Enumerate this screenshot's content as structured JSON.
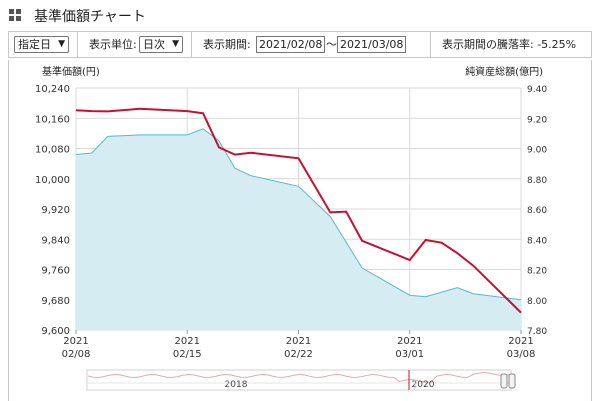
{
  "title": "基準価額チャート",
  "controls": {
    "period_select": "指定日",
    "unit_label": "表示単位:",
    "unit_select": "日次",
    "range_label": "表示期間:",
    "start_date": "2021/02/08",
    "range_sep": "〜",
    "end_date": "2021/03/08",
    "change_label": "表示期間の騰落率: -5.25%"
  },
  "chart_data": {
    "type": "line",
    "left_axis_title": "基準価額(円)",
    "right_axis_title": "純資産総額(億円)",
    "y_left_ticks": [
      "10,240",
      "10,160",
      "10,080",
      "10,000",
      "9,920",
      "9,840",
      "9,760",
      "9,680",
      "9,600"
    ],
    "y_right_ticks": [
      "9.40",
      "9.20",
      "9.00",
      "8.80",
      "8.60",
      "8.40",
      "8.20",
      "8.00",
      "7.80"
    ],
    "ylim_left": [
      9600,
      10240
    ],
    "ylim_right": [
      7.8,
      9.4
    ],
    "x_ticks": [
      {
        "year": "2021",
        "date": "02/08"
      },
      {
        "year": "2021",
        "date": "02/15"
      },
      {
        "year": "2021",
        "date": "02/22"
      },
      {
        "year": "2021",
        "date": "03/01"
      },
      {
        "year": "2021",
        "date": "03/08"
      }
    ],
    "series": [
      {
        "axis": "left",
        "color": "#c8102e",
        "points": [
          {
            "date": "2021/02/08",
            "value": 10181
          },
          {
            "date": "2021/02/09",
            "value": 10179
          },
          {
            "date": "2021/02/10",
            "value": 10178
          },
          {
            "date": "2021/02/12",
            "value": 10185
          },
          {
            "date": "2021/02/15",
            "value": 10179
          },
          {
            "date": "2021/02/16",
            "value": 10173
          },
          {
            "date": "2021/02/17",
            "value": 10083
          },
          {
            "date": "2021/02/18",
            "value": 10064
          },
          {
            "date": "2021/02/19",
            "value": 10069
          },
          {
            "date": "2021/02/22",
            "value": 10054
          },
          {
            "date": "2021/02/24",
            "value": 9911
          },
          {
            "date": "2021/02/25",
            "value": 9913
          },
          {
            "date": "2021/02/26",
            "value": 9836
          },
          {
            "date": "2021/03/01",
            "value": 9785
          },
          {
            "date": "2021/03/02",
            "value": 9838
          },
          {
            "date": "2021/03/03",
            "value": 9831
          },
          {
            "date": "2021/03/04",
            "value": 9803
          },
          {
            "date": "2021/03/05",
            "value": 9770
          },
          {
            "date": "2021/03/08",
            "value": 9646
          }
        ]
      },
      {
        "axis": "right",
        "color": "#5bb7c9",
        "fill": "#d5ecf2",
        "points": [
          {
            "date": "2021/02/08",
            "value": 8.96
          },
          {
            "date": "2021/02/09",
            "value": 8.97
          },
          {
            "date": "2021/02/10",
            "value": 9.08
          },
          {
            "date": "2021/02/12",
            "value": 9.09
          },
          {
            "date": "2021/02/15",
            "value": 9.09
          },
          {
            "date": "2021/02/16",
            "value": 9.13
          },
          {
            "date": "2021/02/17",
            "value": 9.05
          },
          {
            "date": "2021/02/18",
            "value": 8.87
          },
          {
            "date": "2021/02/19",
            "value": 8.82
          },
          {
            "date": "2021/02/22",
            "value": 8.75
          },
          {
            "date": "2021/02/24",
            "value": 8.55
          },
          {
            "date": "2021/02/26",
            "value": 8.21
          },
          {
            "date": "2021/03/01",
            "value": 8.03
          },
          {
            "date": "2021/03/02",
            "value": 8.02
          },
          {
            "date": "2021/03/04",
            "value": 8.08
          },
          {
            "date": "2021/03/05",
            "value": 8.04
          },
          {
            "date": "2021/03/08",
            "value": 8.0
          }
        ]
      }
    ]
  },
  "navigator": {
    "year_labels": [
      "2018",
      "2020"
    ]
  }
}
